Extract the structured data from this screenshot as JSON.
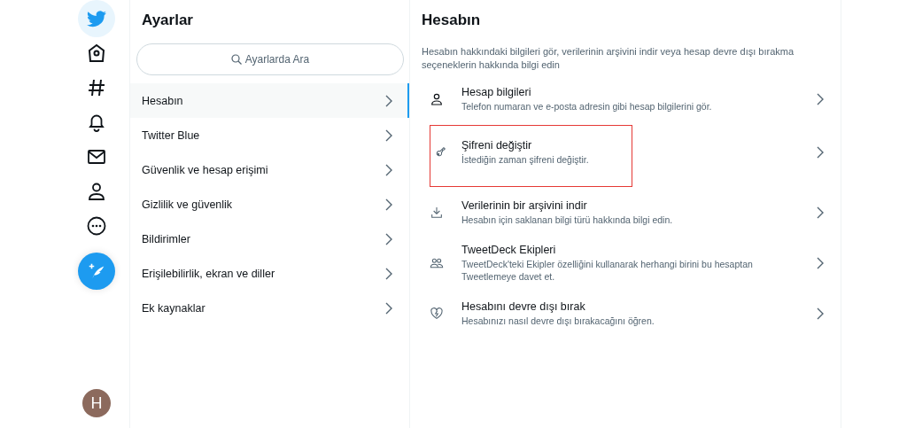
{
  "nav": {
    "items": [
      {
        "kind": "bird",
        "selected": true
      },
      {
        "kind": "home",
        "selected": false
      },
      {
        "kind": "hashtag",
        "selected": false
      },
      {
        "kind": "bell",
        "selected": false
      },
      {
        "kind": "mail",
        "selected": false
      },
      {
        "kind": "person",
        "selected": false
      },
      {
        "kind": "more",
        "selected": false
      }
    ],
    "avatar": "H"
  },
  "settings": {
    "title": "Ayarlar",
    "search": {
      "placeholder": "Ayarlarda Ara"
    },
    "items": [
      {
        "label": "Hesabın",
        "selected": true
      },
      {
        "label": "Twitter Blue",
        "selected": false
      },
      {
        "label": "Güvenlik ve hesap erişimi",
        "selected": false
      },
      {
        "label": "Gizlilik ve güvenlik",
        "selected": false
      },
      {
        "label": "Bildirimler",
        "selected": false
      },
      {
        "label": "Erişilebilirlik, ekran ve diller",
        "selected": false
      },
      {
        "label": "Ek kaynaklar",
        "selected": false
      }
    ]
  },
  "account": {
    "title": "Hesabın",
    "description": "Hesabın hakkındaki bilgileri gör, verilerinin arşivini indir veya hesap devre dışı bırakma seçeneklerin hakkında bilgi edin",
    "items": [
      {
        "kind": "person",
        "title": "Hesap bilgileri",
        "subtitle": "Telefon numaran ve e-posta adresin gibi hesap bilgilerini gör.",
        "highlighted": false
      },
      {
        "kind": "key",
        "title": "Şifreni değiştir",
        "subtitle": "İstediğin zaman şifreni değiştir.",
        "highlighted": true
      },
      {
        "kind": "download",
        "title": "Verilerinin bir arşivini indir",
        "subtitle": "Hesabın için saklanan bilgi türü hakkında bilgi edin.",
        "highlighted": false
      },
      {
        "kind": "people",
        "title": "TweetDeck Ekipleri",
        "subtitle": "TweetDeck'teki Ekipler özelliğini kullanarak herhangi birini bu hesaptan Tweetlemeye davet et.",
        "highlighted": false
      },
      {
        "kind": "heart",
        "title": "Hesabını devre dışı bırak",
        "subtitle": "Hesabınızı nasıl devre dışı bırakacağını öğren.",
        "highlighted": false
      }
    ]
  }
}
